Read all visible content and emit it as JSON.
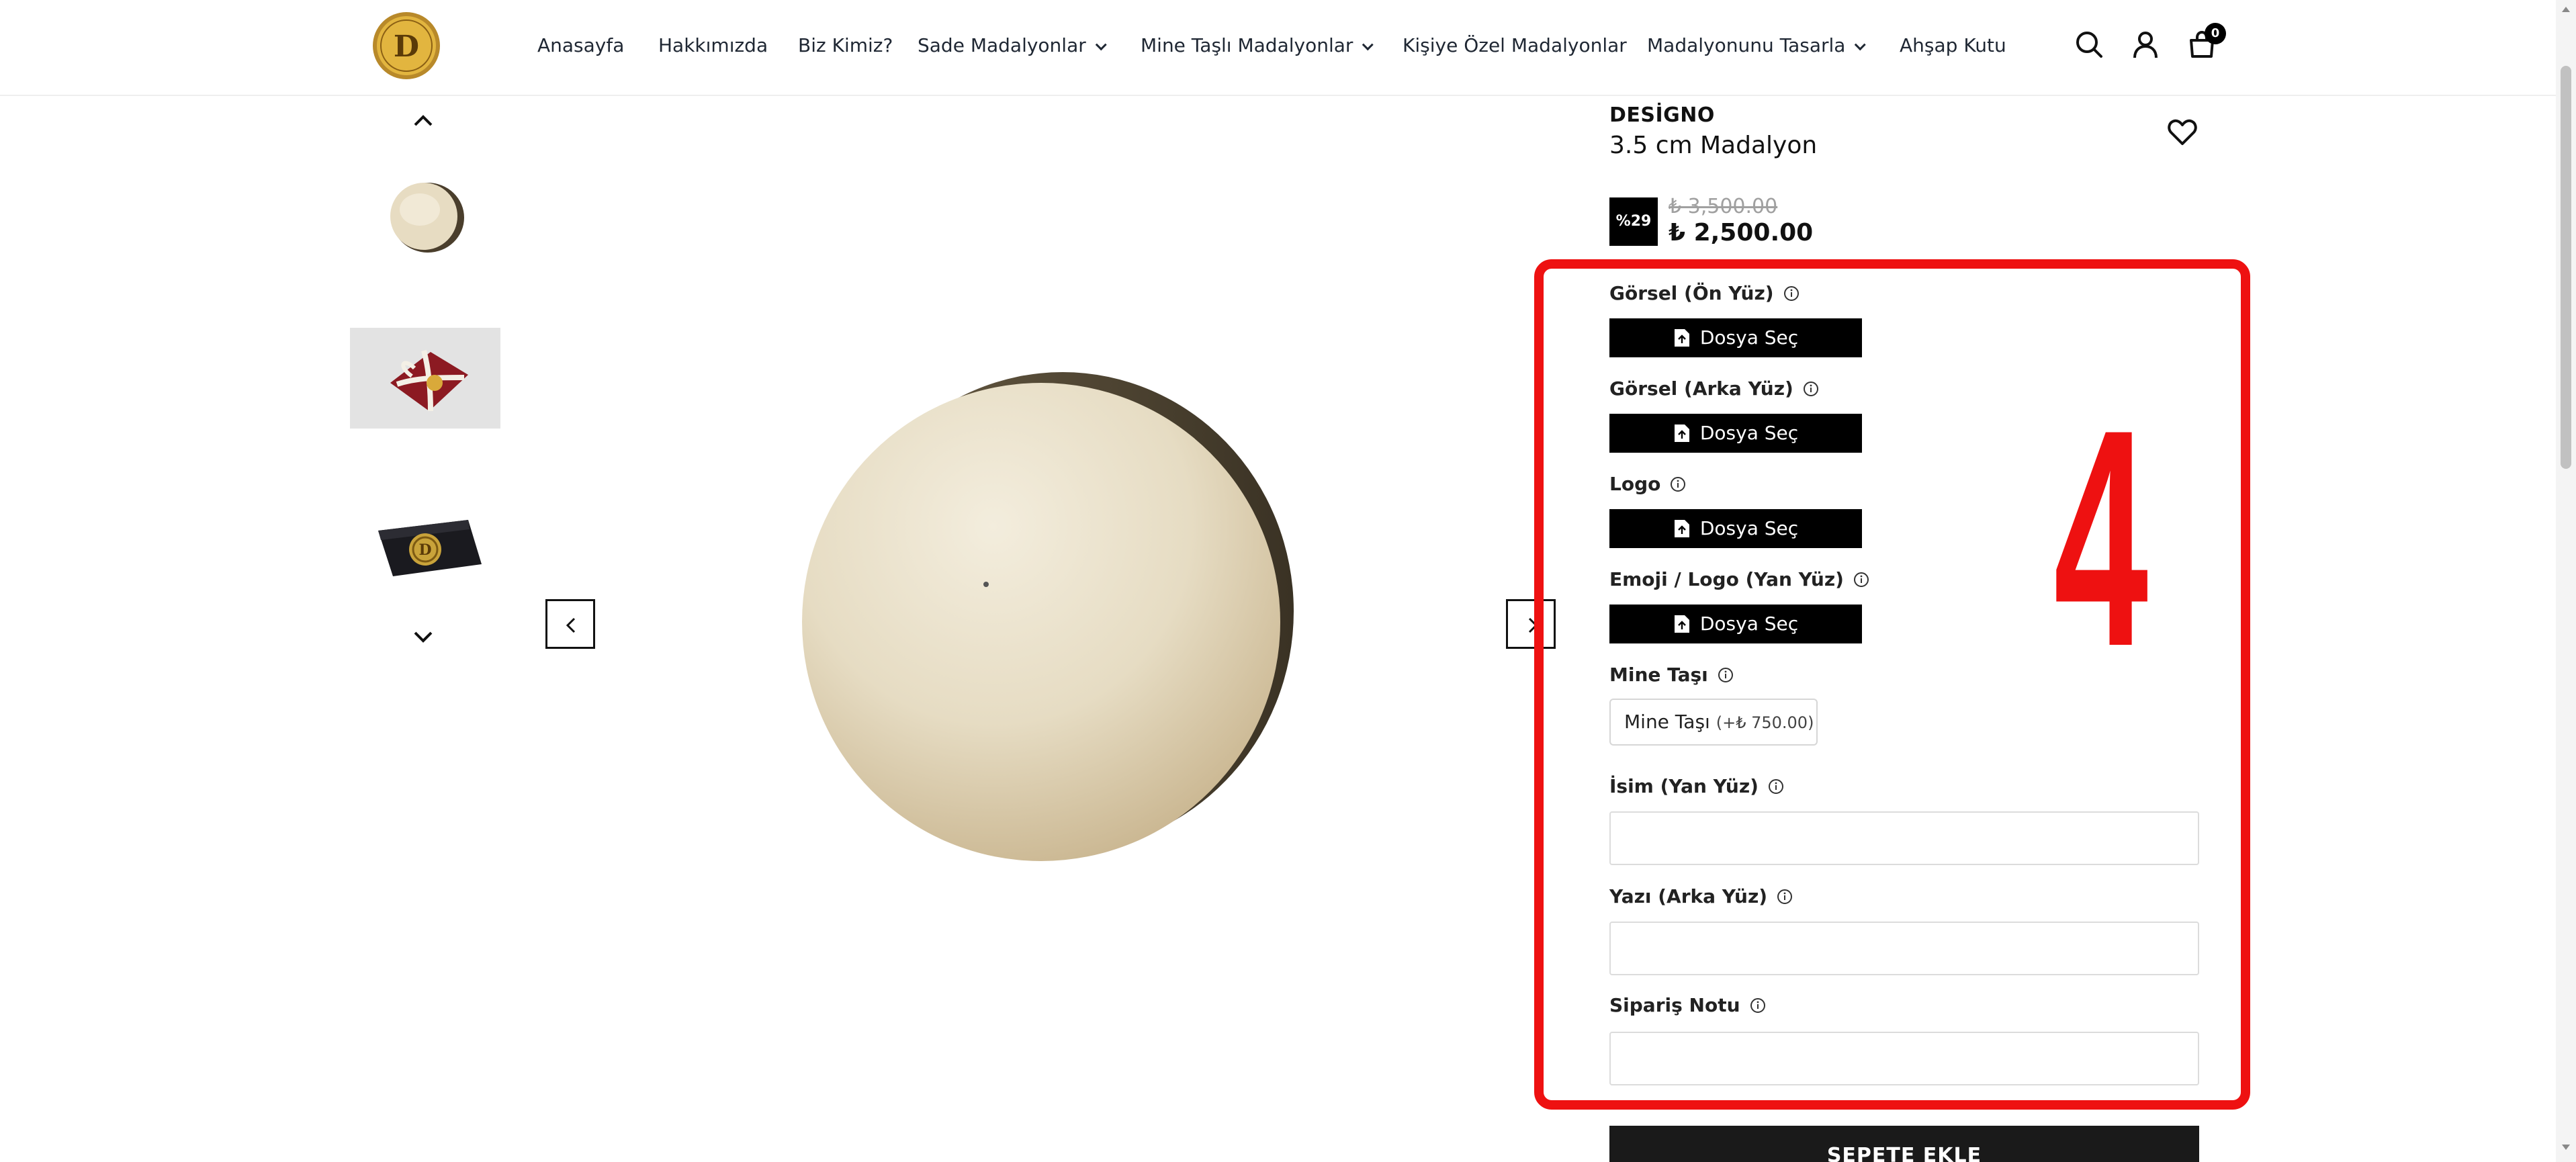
{
  "header": {
    "logo_name": "medallion-logo",
    "nav": [
      {
        "label": "Anasayfa",
        "has_dropdown": false
      },
      {
        "label": "Hakkımızda",
        "has_dropdown": false
      },
      {
        "label": "Biz Kimiz?",
        "has_dropdown": false
      },
      {
        "label": "Sade Madalyonlar",
        "has_dropdown": true
      },
      {
        "label": "Mine Taşlı Madalyonlar",
        "has_dropdown": true
      },
      {
        "label": "Kişiye Özel Madalyonlar",
        "has_dropdown": false
      },
      {
        "label": "Madalyonunu Tasarla",
        "has_dropdown": true
      },
      {
        "label": "Ahşap Kutu",
        "has_dropdown": false
      }
    ],
    "icons": [
      "search-icon",
      "user-icon",
      "cart-icon"
    ],
    "cart_count": "0"
  },
  "gallery": {
    "thumbnails": [
      "medallion-plain",
      "gift-box-red",
      "black-pouch"
    ]
  },
  "product": {
    "brand": "DESİGNO",
    "title": "3.5 cm Madalyon",
    "discount": "%29",
    "old_price": "₺ 3,500.00",
    "new_price": "₺ 2,500.00"
  },
  "form": {
    "fields": [
      {
        "label": "Görsel (Ön Yüz)",
        "button": "Dosya Seç"
      },
      {
        "label": "Görsel (Arka Yüz)",
        "button": "Dosya Seç"
      },
      {
        "label": "Logo",
        "button": "Dosya Seç"
      },
      {
        "label": "Emoji / Logo (Yan Yüz)",
        "button": "Dosya Seç"
      }
    ],
    "mine_tasi": {
      "label": "Mine Taşı",
      "option": "Mine Taşı",
      "option_extra": "(+₺ 750.00)"
    },
    "text_fields": [
      {
        "label": "İsim (Yan Yüz)",
        "value": ""
      },
      {
        "label": "Yazı (Arka Yüz)",
        "value": ""
      },
      {
        "label": "Sipariş Notu",
        "value": ""
      }
    ]
  },
  "annotation": {
    "number": "4",
    "color": "#ee1111"
  },
  "add_to_cart": "SEPETE EKLE"
}
